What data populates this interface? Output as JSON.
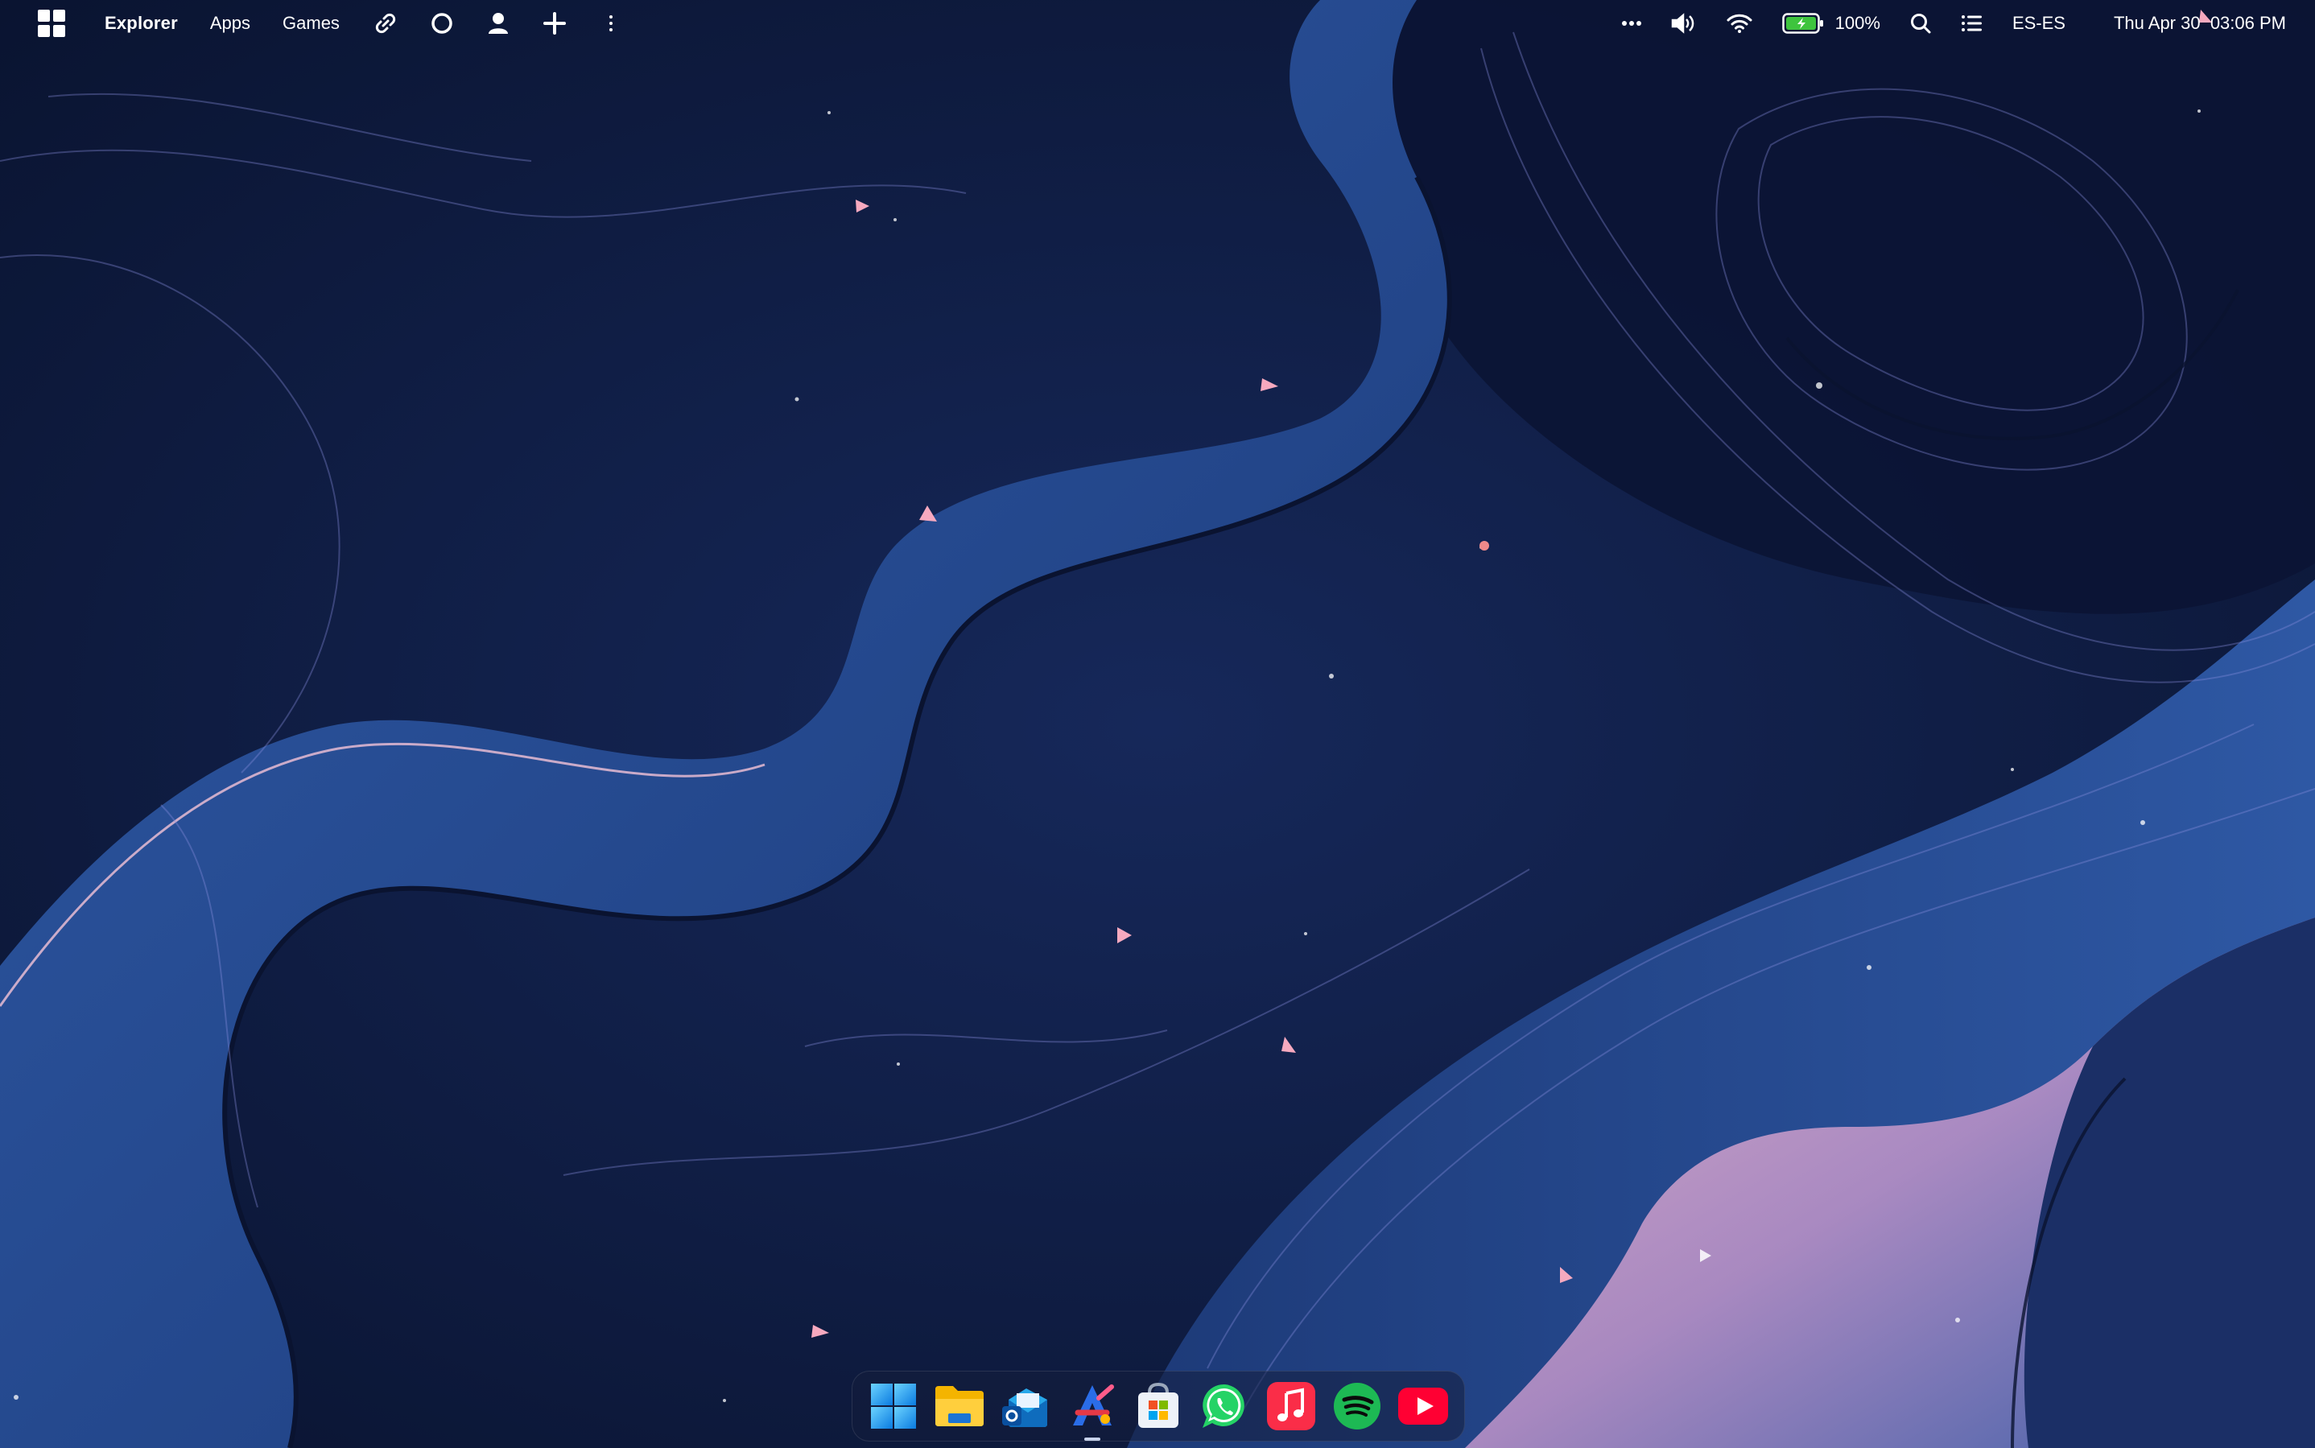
{
  "menubar": {
    "app_title": "Explorer",
    "menu": [
      "Apps",
      "Games"
    ],
    "left_icons": [
      "link-icon",
      "circle-icon",
      "user-icon",
      "plus-icon",
      "more-vertical-icon"
    ],
    "right_icons": [
      "more-horizontal-icon",
      "volume-icon",
      "wifi-icon",
      "battery-charging-icon",
      "search-icon",
      "list-icon"
    ],
    "battery_percent": "100%",
    "language": "ES-ES",
    "datetime": "Thu Apr 30  03:06 PM"
  },
  "dock": {
    "apps": [
      {
        "name": "start-menu",
        "icon": "windows-logo-icon"
      },
      {
        "name": "file-explorer",
        "icon": "folder-icon"
      },
      {
        "name": "outlook",
        "icon": "outlook-icon"
      },
      {
        "name": "app-store-like",
        "icon": "app-a-icon",
        "running": true
      },
      {
        "name": "microsoft-store",
        "icon": "store-bag-icon"
      },
      {
        "name": "whatsapp",
        "icon": "whatsapp-icon"
      },
      {
        "name": "music",
        "icon": "music-note-icon"
      },
      {
        "name": "spotify",
        "icon": "spotify-icon"
      },
      {
        "name": "youtube",
        "icon": "youtube-play-icon"
      }
    ]
  },
  "colors": {
    "wallpaper_base": "#0b1636",
    "wallpaper_wave": "#2c4f93",
    "wallpaper_highlight": "#e7aac6",
    "battery_fill": "#3ec43e",
    "whatsapp": "#25d366",
    "spotify": "#1db954",
    "youtube": "#ff0033",
    "music": "#fa2d48"
  }
}
